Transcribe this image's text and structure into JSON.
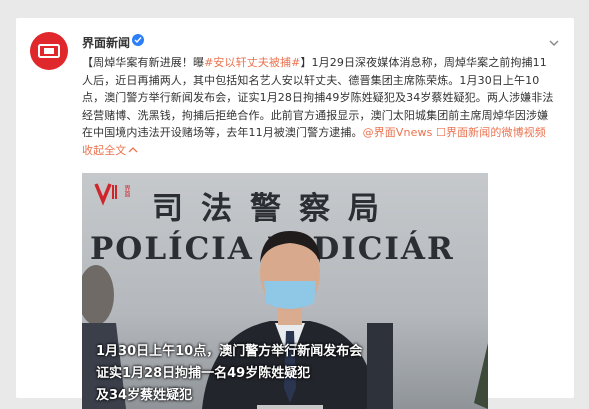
{
  "account": {
    "name": "界面新闻",
    "avatar_icon": "jiemian-logo-icon",
    "verified_icon": "verified-badge-icon",
    "more_icon": "chevron-down-icon"
  },
  "post": {
    "line1_prefix": "【周焯华案有新进展！曝",
    "hashtag": "#安以轩丈夫被捕#",
    "line1_suffix": "】1月29日深夜媒体消息称，周焯华案之前拘捕11",
    "line2": "人后，近日再捕两人，其中包括知名艺人安以轩丈夫、德晋集团主席陈荣炼。1月30日上午10",
    "line3": "点，澳门警方举行新闻发布会，证实1月28日拘捕49岁陈姓疑犯及34岁蔡姓疑犯。两人涉嫌非法",
    "line4": "经营赌博、洗黑钱，拘捕后拒绝合作。此前官方通报显示，澳门太阳城集团前主席周焯华因涉嫌",
    "line5_prefix": "在中国境内违法开设赌场等，去年11月被澳门警方逮捕。",
    "mention": "@界面Vnews",
    "video_link": "☐界面新闻的微博视频",
    "collapse": "收起全文",
    "collapse_icon": "collapse-chevron-icon"
  },
  "video": {
    "brand_logo": "v-brand-logo-icon",
    "brand_text": "界面",
    "sign_chinese": "司法警察局",
    "sign_portuguese": "POLÍCIA JUDICIÁR",
    "caption_line1": "1月30日上午10点，澳门警方举行新闻发布会",
    "caption_line2": "证实1月28日拘捕一名49岁陈姓疑犯",
    "caption_line3": "及34岁蔡姓疑犯"
  }
}
